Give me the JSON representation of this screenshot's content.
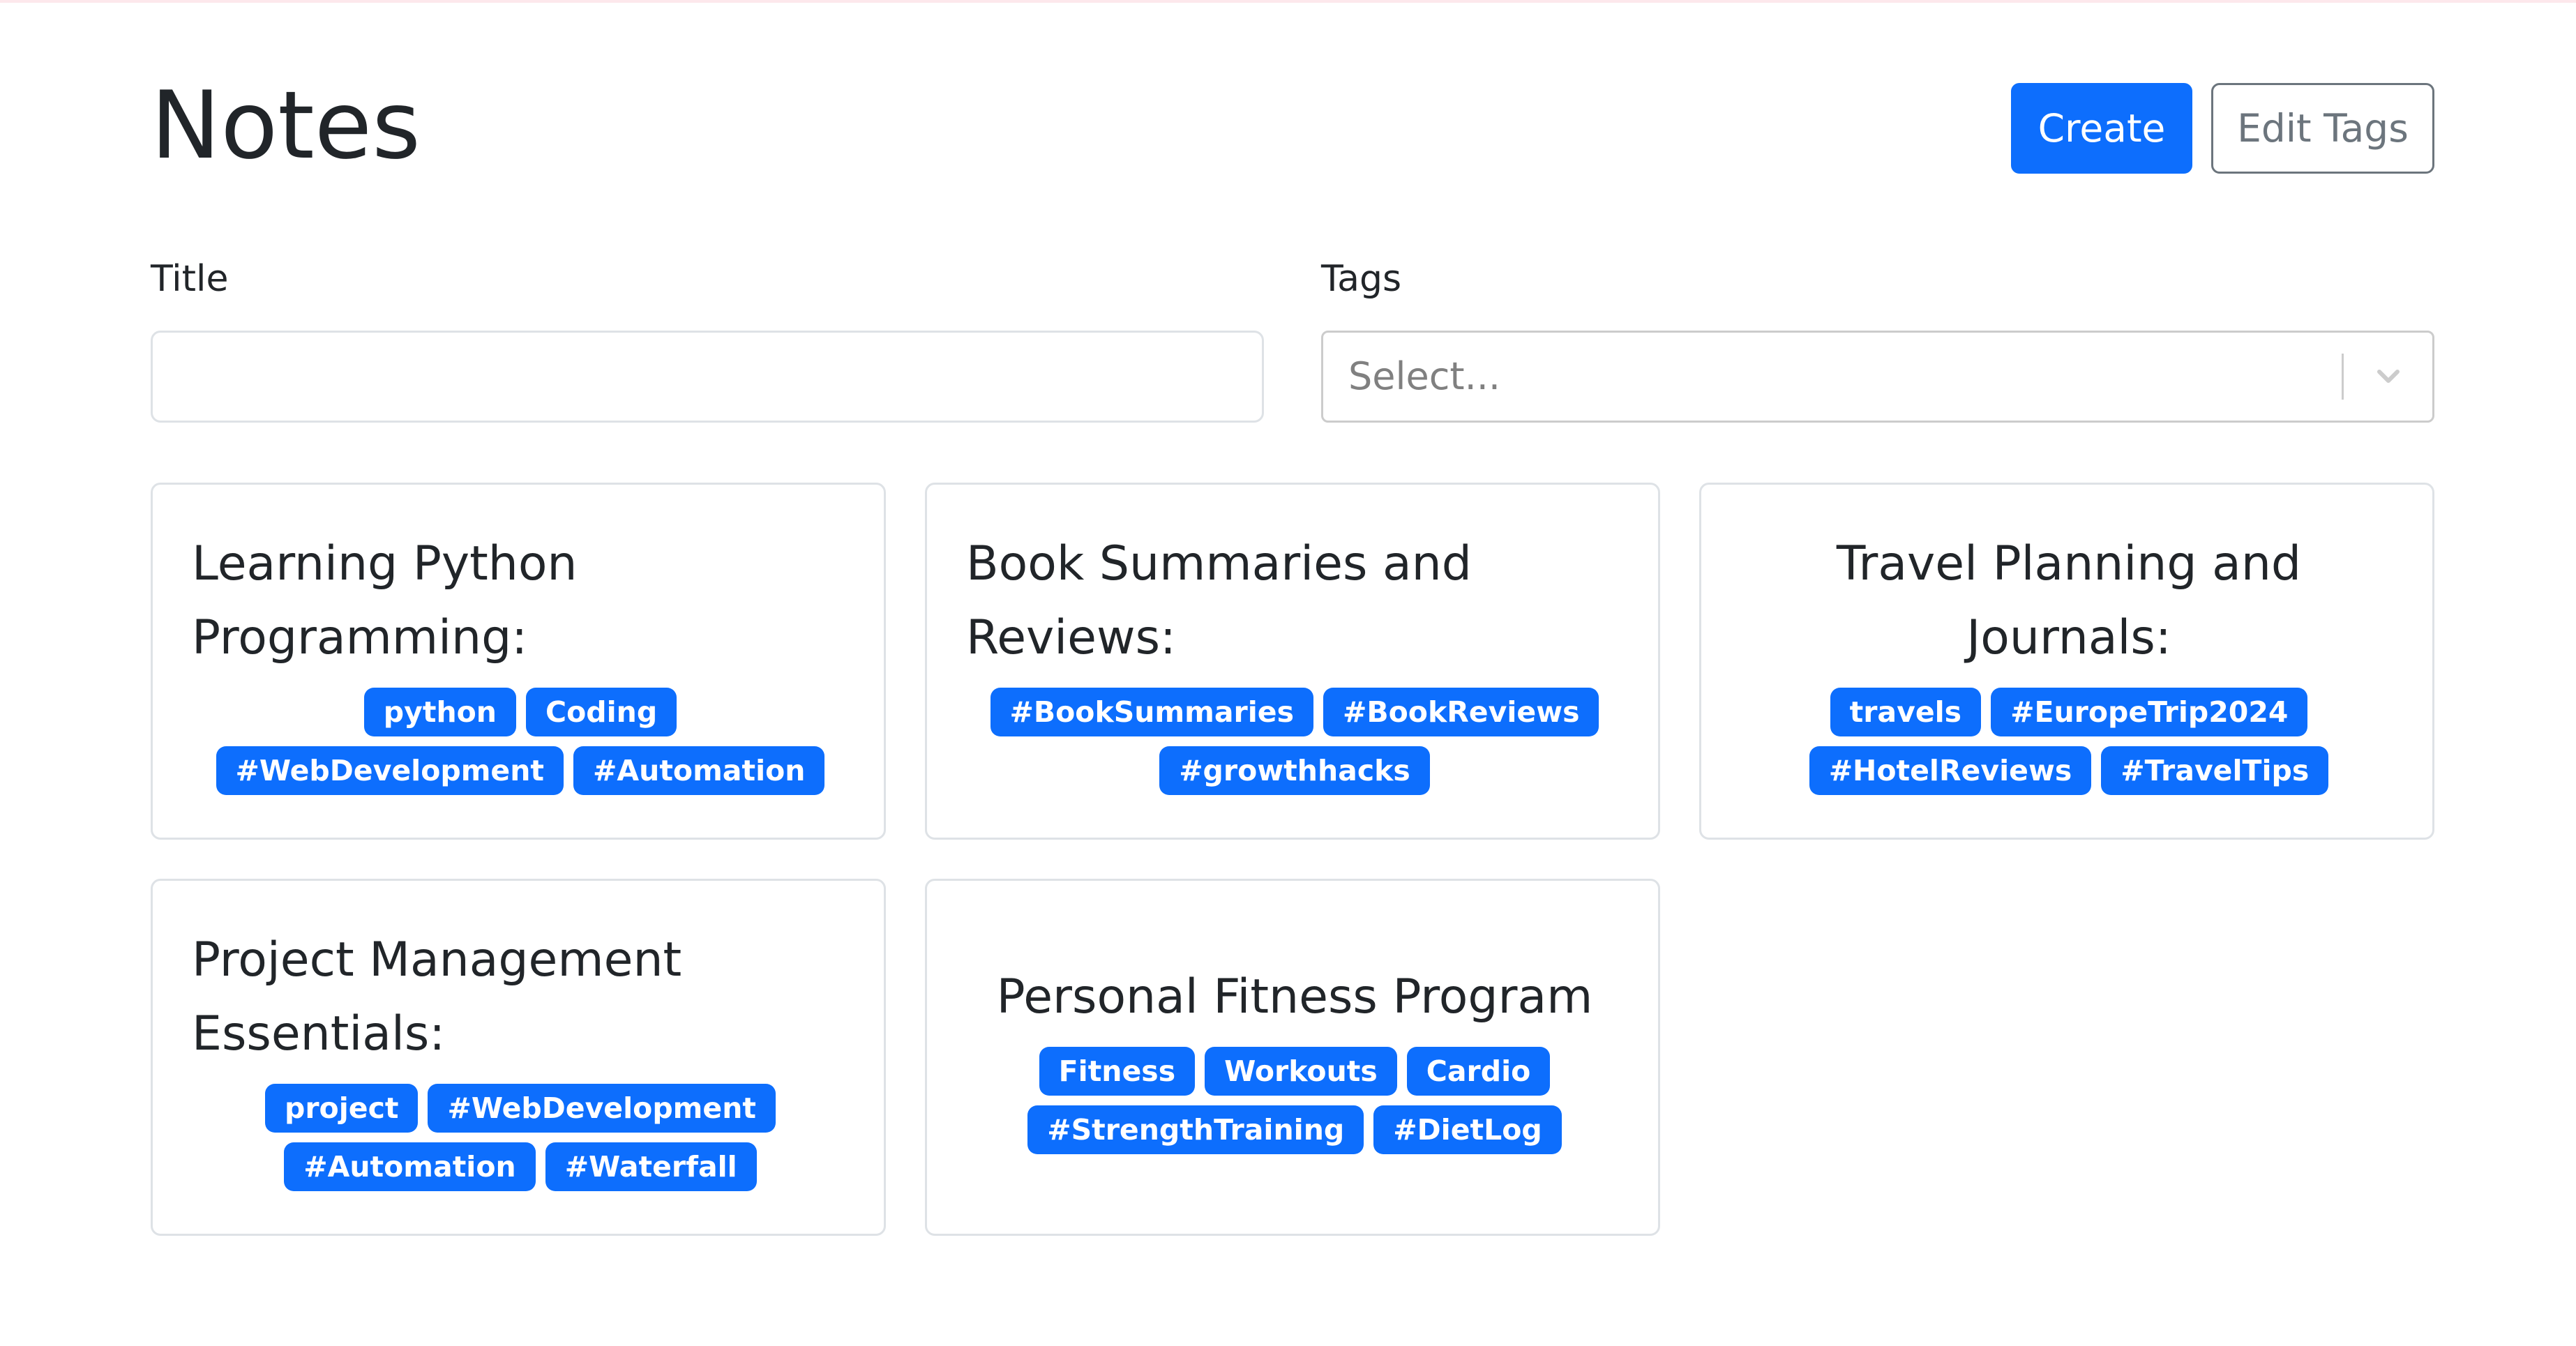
{
  "header": {
    "title": "Notes",
    "create_label": "Create",
    "edit_tags_label": "Edit Tags"
  },
  "filters": {
    "title_label": "Title",
    "title_value": "",
    "tags_label": "Tags",
    "tags_placeholder": "Select..."
  },
  "notes": [
    {
      "title": "Learning Python Programming:",
      "tags": [
        "python",
        "Coding",
        "#WebDevelopment",
        "#Automation"
      ]
    },
    {
      "title": "Book Summaries and Reviews:",
      "tags": [
        "#BookSummaries",
        "#BookReviews",
        "#growthhacks"
      ]
    },
    {
      "title": "Travel Planning and Journals:",
      "tags": [
        "travels",
        "#EuropeTrip2024",
        "#HotelReviews",
        "#TravelTips"
      ]
    },
    {
      "title": "Project Management Essentials:",
      "tags": [
        "project",
        "#WebDevelopment",
        "#Automation",
        "#Waterfall"
      ]
    },
    {
      "title": "Personal Fitness Program",
      "tags": [
        "Fitness",
        "Workouts",
        "Cardio",
        "#StrengthTraining",
        "#DietLog"
      ]
    }
  ],
  "colors": {
    "primary": "#0d6efd",
    "secondary": "#6c757d",
    "border": "#dee2e6"
  },
  "icons": {
    "select_indicator": "chevron-down-icon"
  }
}
